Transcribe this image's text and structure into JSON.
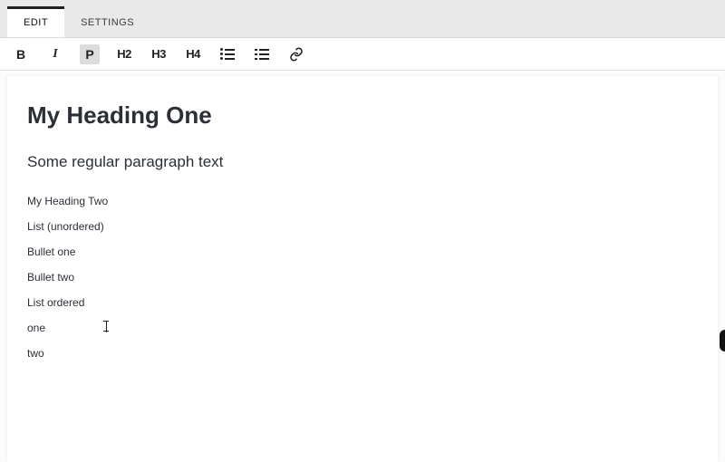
{
  "tabs": [
    {
      "label": "EDIT",
      "active": true
    },
    {
      "label": "SETTINGS",
      "active": false
    }
  ],
  "toolbar": {
    "bold": "B",
    "italic": "I",
    "paragraph": "P",
    "h2": "H2",
    "h3": "H3",
    "h4": "H4"
  },
  "content": {
    "heading1": "My Heading One",
    "paragraph": "Some regular paragraph text",
    "lines": [
      "My Heading Two",
      "List (unordered)",
      "Bullet one",
      "Bullet two",
      "List ordered",
      "one",
      "two"
    ]
  }
}
